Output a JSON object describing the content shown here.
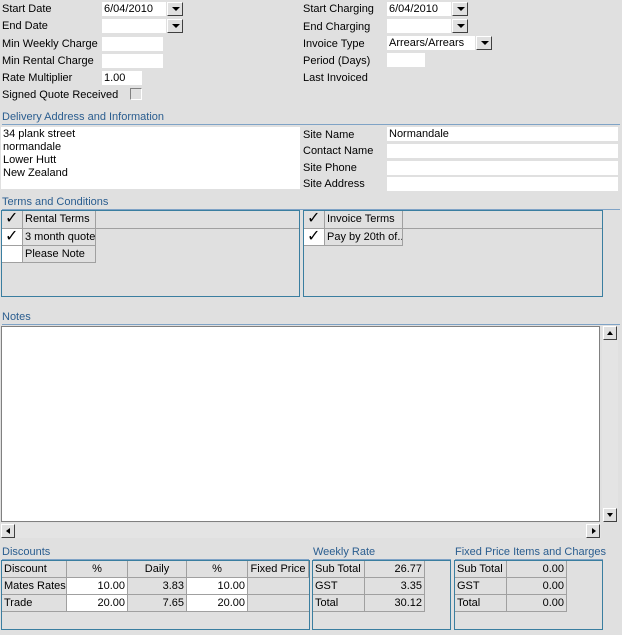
{
  "left_fields": {
    "start_date": {
      "label": "Start Date",
      "value": "6/04/2010"
    },
    "end_date": {
      "label": "End Date",
      "value": ""
    },
    "min_weekly_charge": {
      "label": "Min Weekly Charge",
      "value": ""
    },
    "min_rental_charge": {
      "label": "Min Rental Charge",
      "value": ""
    },
    "rate_multiplier": {
      "label": "Rate Multiplier",
      "value": "1.00"
    },
    "signed_quote": {
      "label": "Signed Quote Received",
      "checked": false
    }
  },
  "right_fields": {
    "start_charging": {
      "label": "Start Charging",
      "value": "6/04/2010"
    },
    "end_charging": {
      "label": "End Charging",
      "value": ""
    },
    "invoice_type": {
      "label": "Invoice Type",
      "value": "Arrears/Arrears"
    },
    "period_days": {
      "label": "Period (Days)",
      "value": ""
    },
    "last_invoiced": {
      "label": "Last Invoiced",
      "value": ""
    }
  },
  "delivery": {
    "title": "Delivery Address and Information",
    "address_lines": [
      "34 plank street",
      "normandale",
      "Lower Hutt",
      "New Zealand"
    ],
    "site_name": {
      "label": "Site Name",
      "value": "Normandale"
    },
    "contact_name": {
      "label": "Contact Name",
      "value": ""
    },
    "site_phone": {
      "label": "Site Phone",
      "value": ""
    },
    "site_address": {
      "label": "Site Address",
      "value": ""
    }
  },
  "terms": {
    "title": "Terms and Conditions",
    "rental_header": "Rental Terms",
    "rental_rows": [
      {
        "checked": true,
        "label": "3 month quote"
      },
      {
        "checked": false,
        "label": "Please Note"
      }
    ],
    "invoice_header": "Invoice Terms",
    "invoice_rows": [
      {
        "checked": true,
        "label": "Pay by 20th of.."
      }
    ],
    "check_glyph": "✓"
  },
  "notes": {
    "title": "Notes",
    "text": ""
  },
  "discounts": {
    "title": "Discounts",
    "headers": [
      "Discount",
      "%",
      "Daily",
      "%",
      "Fixed Price"
    ],
    "rows": [
      {
        "name": "Mates Rates",
        "pct": "10.00",
        "daily": "3.83",
        "pct2": "10.00",
        "fixed": ""
      },
      {
        "name": "Trade",
        "pct": "20.00",
        "daily": "7.65",
        "pct2": "20.00",
        "fixed": ""
      }
    ]
  },
  "weekly_rate": {
    "title": "Weekly Rate",
    "rows": [
      {
        "label": "Sub Total",
        "value": "26.77"
      },
      {
        "label": "GST",
        "value": "3.35"
      },
      {
        "label": "Total",
        "value": "30.12"
      }
    ]
  },
  "fixed_price": {
    "title": "Fixed Price Items and Charges",
    "rows": [
      {
        "label": "Sub Total",
        "value": "0.00"
      },
      {
        "label": "GST",
        "value": "0.00"
      },
      {
        "label": "Total",
        "value": "0.00"
      }
    ]
  }
}
